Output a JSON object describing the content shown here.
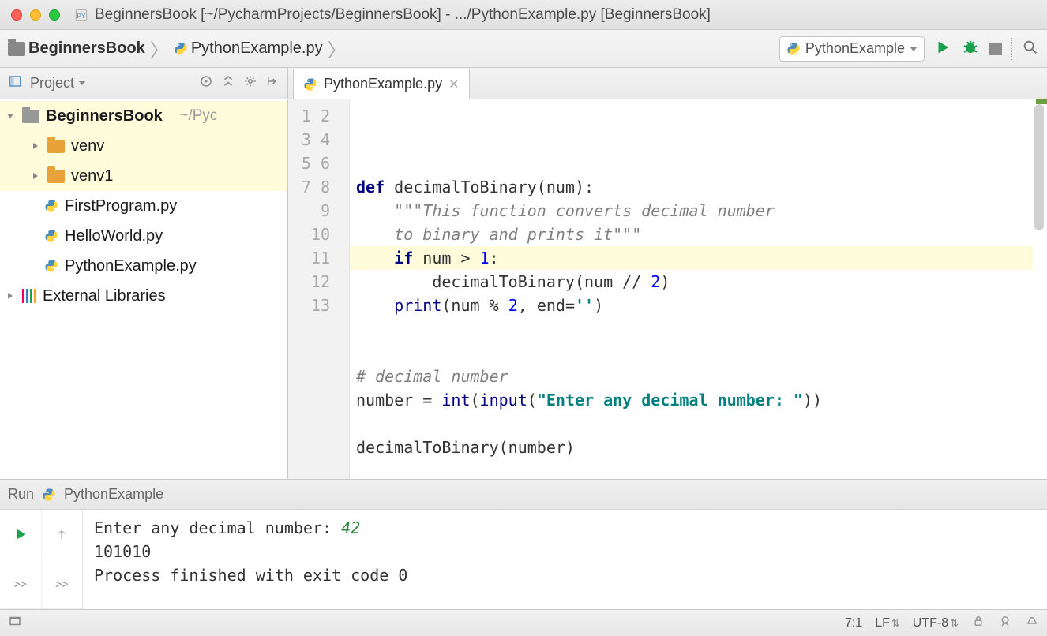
{
  "window": {
    "title": "BeginnersBook [~/PycharmProjects/BeginnersBook] - .../PythonExample.py [BeginnersBook]"
  },
  "breadcrumb": {
    "project": "BeginnersBook",
    "file": "PythonExample.py"
  },
  "run_config": {
    "label": "PythonExample"
  },
  "project_tool": {
    "label": "Project"
  },
  "editor_tab": {
    "label": "PythonExample.py"
  },
  "tree": {
    "root": {
      "name": "BeginnersBook",
      "path": "~/Pyc"
    },
    "children": [
      {
        "name": "venv",
        "type": "folder"
      },
      {
        "name": "venv1",
        "type": "folder"
      },
      {
        "name": "FirstProgram.py",
        "type": "pyfile"
      },
      {
        "name": "HelloWorld.py",
        "type": "pyfile"
      },
      {
        "name": "PythonExample.py",
        "type": "pyfile"
      }
    ],
    "external": "External Libraries"
  },
  "code": {
    "line_count": 13,
    "highlight_line": 7,
    "l1_def": "def ",
    "l1_name": "decimalToBinary(num):",
    "l2": "\"\"\"This function converts decimal number",
    "l3": "to binary and prints it\"\"\"",
    "l4_if": "if ",
    "l4_rest": "num > ",
    "l4_num": "1",
    "l4_colon": ":",
    "l5": "decimalToBinary(num // ",
    "l5_num": "2",
    "l5_close": ")",
    "l6_print": "print",
    "l6_args_a": "(num % ",
    "l6_num": "2",
    "l6_args_b": ", end=",
    "l6_str": "''",
    "l6_close": ")",
    "l9": "# decimal number",
    "l10_a": "number = ",
    "l10_int": "int",
    "l10_b": "(",
    "l10_input": "input",
    "l10_c": "(",
    "l10_str": "\"Enter any decimal number: \"",
    "l10_d": "))",
    "l12": "decimalToBinary(number)"
  },
  "run": {
    "title": "Run",
    "name": "PythonExample",
    "out_prompt": "Enter any decimal number: ",
    "out_input": "42",
    "out_result": "101010",
    "out_exit": "Process finished with exit code 0",
    "rewind": ">>"
  },
  "status": {
    "pos": "7:1",
    "line_sep": "LF",
    "encoding": "UTF-8"
  }
}
